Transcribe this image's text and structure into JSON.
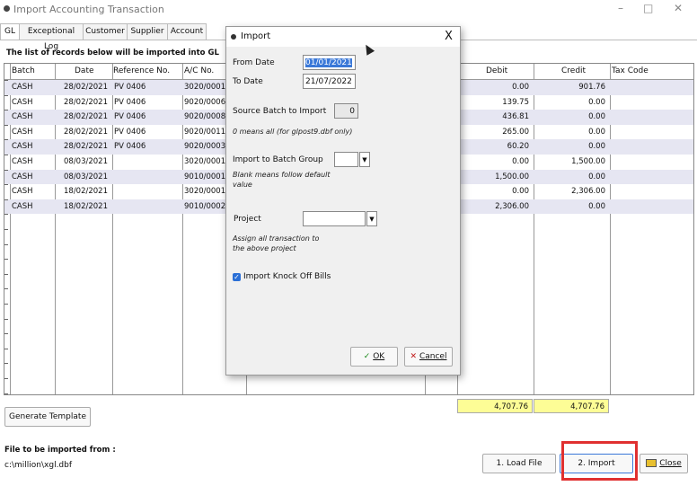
{
  "window": {
    "title": "Import Accounting Transaction",
    "minimize": "–",
    "maximize": "□",
    "close": "✕"
  },
  "tabs": [
    "GL",
    "Exceptional Log",
    "Customer",
    "Supplier",
    "Account"
  ],
  "caption": "The list of records below will be imported into GL",
  "columns": [
    "Batch",
    "Date",
    "Reference No.",
    "A/C No.",
    "Debit",
    "Credit",
    "Tax Code"
  ],
  "rows": [
    {
      "batch": "CASH",
      "date": "28/02/2021",
      "ref": "PV 0406",
      "ac": "3020/0001",
      "debit": "0.00",
      "credit": "901.76"
    },
    {
      "batch": "CASH",
      "date": "28/02/2021",
      "ref": "PV 0406",
      "ac": "9020/0006",
      "debit": "139.75",
      "credit": "0.00"
    },
    {
      "batch": "CASH",
      "date": "28/02/2021",
      "ref": "PV 0406",
      "ac": "9020/0008",
      "debit": "436.81",
      "credit": "0.00"
    },
    {
      "batch": "CASH",
      "date": "28/02/2021",
      "ref": "PV 0406",
      "ac": "9020/0011",
      "debit": "265.00",
      "credit": "0.00"
    },
    {
      "batch": "CASH",
      "date": "28/02/2021",
      "ref": "PV 0406",
      "ac": "9020/0003",
      "debit": "60.20",
      "credit": "0.00"
    },
    {
      "batch": "CASH",
      "date": "08/03/2021",
      "ref": "",
      "ac": "3020/0001",
      "debit": "0.00",
      "credit": "1,500.00"
    },
    {
      "batch": "CASH",
      "date": "08/03/2021",
      "ref": "",
      "ac": "9010/0001",
      "debit": "1,500.00",
      "credit": "0.00"
    },
    {
      "batch": "CASH",
      "date": "18/02/2021",
      "ref": "",
      "ac": "3020/0001",
      "debit": "0.00",
      "credit": "2,306.00"
    },
    {
      "batch": "CASH",
      "date": "18/02/2021",
      "ref": "",
      "ac": "9010/0002",
      "debit": "2,306.00",
      "credit": "0.00"
    }
  ],
  "totals": {
    "debit": "4,707.76",
    "credit": "4,707.76"
  },
  "buttons": {
    "generate_template": "Generate Template",
    "load_file": "1. Load File",
    "import": "2. Import",
    "close": "Close"
  },
  "file": {
    "label": "File to be imported from :",
    "path": "c:\\million\\xgl.dbf"
  },
  "dialog": {
    "title": "Import",
    "close": "X",
    "from_date_label": "From Date",
    "from_date": "01/01/2021",
    "to_date_label": "To Date",
    "to_date": "21/07/2022",
    "source_batch_label": "Source Batch to Import",
    "source_batch": "0",
    "source_batch_note": "0 means all (for glpost9.dbf only)",
    "batch_group_label": "Import to Batch Group",
    "batch_group": "",
    "batch_group_note": "Blank means follow default value",
    "project_label": "Project",
    "project": "",
    "project_note": "Assign all transaction to the above project",
    "knock_off_label": "Import Knock Off Bills",
    "knock_off_checked": true,
    "ok": "OK",
    "cancel": "Cancel"
  }
}
